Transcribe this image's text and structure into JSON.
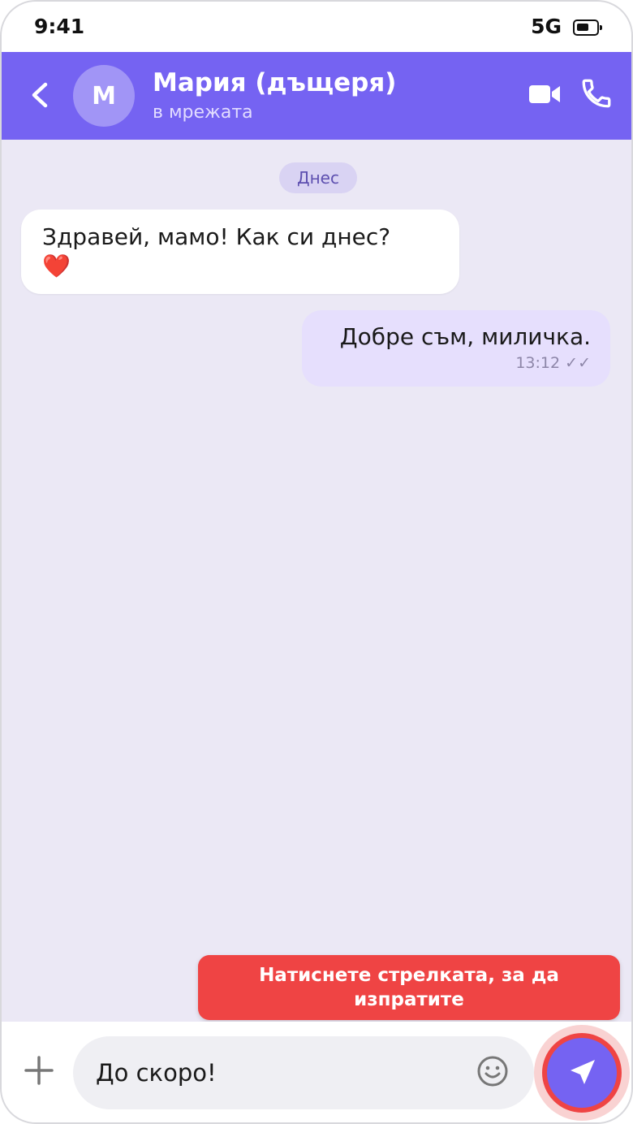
{
  "status_bar": {
    "time": "9:41",
    "network": "5G",
    "battery_icon": "battery-icon"
  },
  "header": {
    "back_icon": "chevron-left-icon",
    "avatar_initial": "М",
    "contact_name": "Мария (дъщеря)",
    "contact_status": "в мрежата",
    "video_icon": "video-camera-icon",
    "call_icon": "phone-icon"
  },
  "chat": {
    "date_label": "Днес",
    "messages": [
      {
        "direction": "incoming",
        "text": "Здравей, мамо! Как си днес?",
        "emoji": "❤️"
      },
      {
        "direction": "outgoing",
        "text": "Добре съм, миличка.",
        "time": "13:12",
        "status_icon": "✓✓"
      }
    ]
  },
  "hint": {
    "text": "Натиснете стрелката, за да изпратите"
  },
  "composer": {
    "attach_icon": "plus-icon",
    "message_value": "До скоро!",
    "emoji_icon": "smiley-icon",
    "send_icon": "send-arrow-icon"
  },
  "colors": {
    "accent": "#7563f2",
    "chat_background": "#ebe8f5",
    "outgoing_bubble": "#e6dffd",
    "hint_red": "#ef4444"
  }
}
